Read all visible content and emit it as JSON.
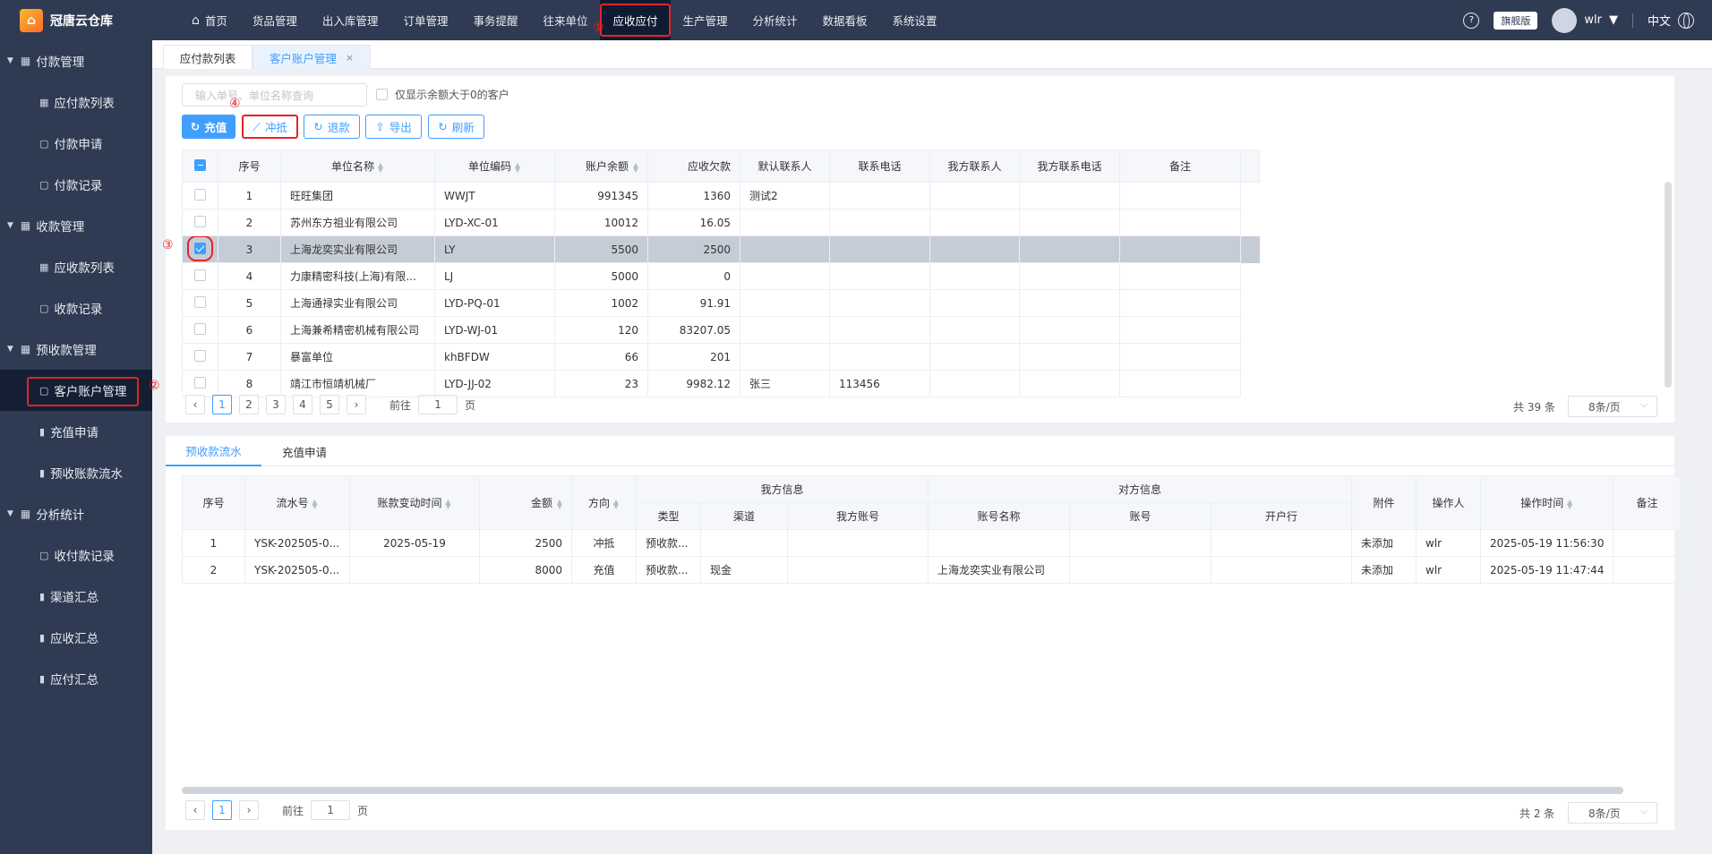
{
  "app": {
    "name": "冠唐云仓库"
  },
  "nav": {
    "items": [
      "首页",
      "货品管理",
      "出入库管理",
      "订单管理",
      "事务提醒",
      "往来单位",
      "应收应付",
      "生产管理",
      "分析统计",
      "数据看板",
      "系统设置"
    ]
  },
  "topright": {
    "edition": "旗舰版",
    "user": "wlr",
    "lang": "中文"
  },
  "annotations": {
    "a1": "①",
    "a2": "②",
    "a3": "③",
    "a4": "④"
  },
  "sidebar": {
    "groups": [
      {
        "label": "付款管理",
        "items": [
          "应付款列表",
          "付款申请",
          "付款记录"
        ]
      },
      {
        "label": "收款管理",
        "items": [
          "应收款列表",
          "收款记录"
        ]
      },
      {
        "label": "预收款管理",
        "items": [
          "客户账户管理",
          "充值申请",
          "预收账款流水"
        ]
      },
      {
        "label": "分析统计",
        "items": [
          "收付款记录",
          "渠道汇总",
          "应收汇总",
          "应付汇总"
        ]
      }
    ]
  },
  "page_tabs": {
    "tab1": "应付款列表",
    "tab2": "客户账户管理",
    "close": "×"
  },
  "toolbar": {
    "search_placeholder": "输入单号、单位名称查询",
    "filter_label": "仅显示余额大于0的客户",
    "recharge": "充值",
    "offset": "冲抵",
    "refund": "退款",
    "export": "导出",
    "refresh": "刷新"
  },
  "accounts_table": {
    "headers": [
      "序号",
      "单位名称",
      "单位编码",
      "账户余额",
      "应收欠款",
      "默认联系人",
      "联系电话",
      "我方联系人",
      "我方联系电话",
      "备注"
    ],
    "rows": [
      [
        "1",
        "旺旺集团",
        "WWJT",
        "991345",
        "1360",
        "测试2",
        "",
        "",
        "",
        ""
      ],
      [
        "2",
        "苏州东方祖业有限公司",
        "LYD-XC-01",
        "10012",
        "16.05",
        "",
        "",
        "",
        "",
        ""
      ],
      [
        "3",
        "上海龙奕实业有限公司",
        "LY",
        "5500",
        "2500",
        "",
        "",
        "",
        "",
        ""
      ],
      [
        "4",
        "力康精密科技(上海)有限...",
        "LJ",
        "5000",
        "0",
        "",
        "",
        "",
        "",
        ""
      ],
      [
        "5",
        "上海通禄实业有限公司",
        "LYD-PQ-01",
        "1002",
        "91.91",
        "",
        "",
        "",
        "",
        ""
      ],
      [
        "6",
        "上海兼希精密机械有限公司",
        "LYD-WJ-01",
        "120",
        "83207.05",
        "",
        "",
        "",
        "",
        ""
      ],
      [
        "7",
        "暴富单位",
        "khBFDW",
        "66",
        "201",
        "",
        "",
        "",
        "",
        ""
      ],
      [
        "8",
        "靖江市恒靖机械厂",
        "LYD-JJ-02",
        "23",
        "9982.12",
        "张三",
        "113456",
        "",
        "",
        ""
      ]
    ],
    "selected_row": 3
  },
  "pager1": {
    "pages": [
      "1",
      "2",
      "3",
      "4",
      "5"
    ],
    "goto_label": "前往",
    "goto_value": "1",
    "page_unit": "页",
    "total": "共 39 条",
    "page_size": "8条/页"
  },
  "bottom_tabs": {
    "tab1": "预收款流水",
    "tab2": "充值申请"
  },
  "flow_table": {
    "headers_top": [
      "序号",
      "流水号",
      "账款变动时间",
      "金额",
      "方向",
      "我方信息",
      "对方信息",
      "附件",
      "操作人",
      "操作时间",
      "备注"
    ],
    "headers_sub": [
      "类型",
      "渠道",
      "我方账号",
      "账号名称",
      "账号",
      "开户行"
    ],
    "rows": [
      [
        "1",
        "YSK-202505-0...",
        "2025-05-19",
        "2500",
        "冲抵",
        "预收款...",
        "",
        "",
        "",
        "",
        "",
        "未添加",
        "wlr",
        "2025-05-19 11:56:30",
        ""
      ],
      [
        "2",
        "YSK-202505-0...",
        "",
        "8000",
        "充值",
        "预收款...",
        "现金",
        "",
        "上海龙奕实业有限公司",
        "",
        "",
        "未添加",
        "wlr",
        "2025-05-19 11:47:44",
        ""
      ]
    ]
  },
  "pager2": {
    "page": "1",
    "goto_label": "前往",
    "goto_value": "1",
    "page_unit": "页",
    "total": "共 2 条",
    "page_size": "8条/页"
  },
  "colors": {
    "nav_bg": "#2f3b52",
    "accent": "#409eff",
    "highlight": "#e52424",
    "selected_row": "#c6ccd6"
  }
}
